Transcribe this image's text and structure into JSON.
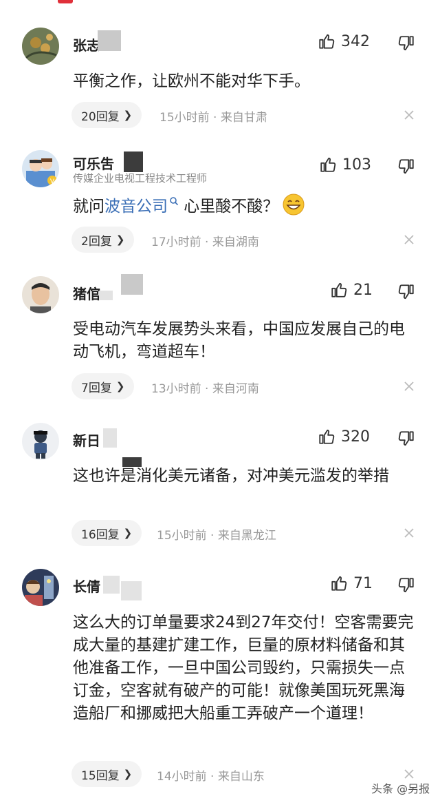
{
  "comments": [
    {
      "username": "张志",
      "likes": "342",
      "text": "平衡之作，让欧州不能对华下手。",
      "replies": "20回复",
      "time": "15小时前",
      "location": "来自甘肃"
    },
    {
      "username": "可乐吿",
      "subtitle": "传媒企业电视工程技术工程师",
      "likes": "103",
      "text_before": "就问",
      "text_link": "波音公司",
      "text_after": " 心里酸不酸？",
      "replies": "2回复",
      "time": "17小时前",
      "location": "来自湖南"
    },
    {
      "username": "猪倌",
      "likes": "21",
      "text": "受电动汽车发展势头来看，中国应发展自己的电动飞机，弯道超车！",
      "replies": "7回复",
      "time": "13小时前",
      "location": "来自河南"
    },
    {
      "username": "新日",
      "likes": "320",
      "text": "这也许是消化美元诸备，对冲美元滥发的举措",
      "replies": "16回复",
      "time": "15小时前",
      "location": "来自黑龙江"
    },
    {
      "username": "长倩",
      "likes": "71",
      "text": "这么大的订单量要求24到27年交付！空客需要完成大量的基建扩建工作，巨量的原材料储备和其他准备工作，一旦中国公司毁约，只需损失一点订金，空客就有破产的可能！就像美国玩死黑海造船厂和挪威把大船重工弄破产一个道理！",
      "replies": "15回复",
      "time": "14小时前",
      "location": "来自山东"
    }
  ],
  "separator": "·",
  "watermark": "头条 @另报",
  "colors": {
    "link": "#3b6fb6",
    "accent": "#e0303a"
  }
}
